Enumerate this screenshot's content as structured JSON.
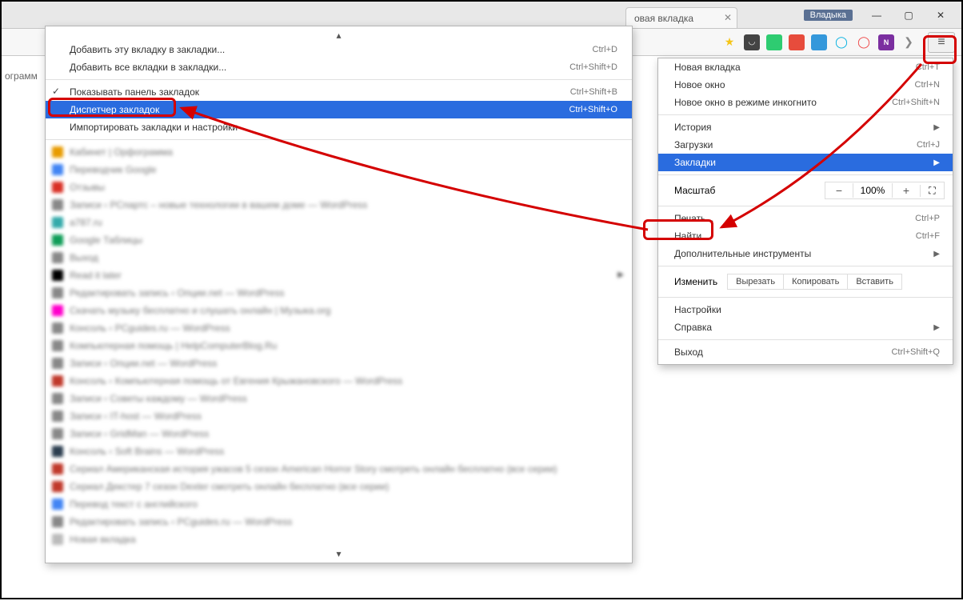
{
  "browser": {
    "tab_title": "овая вкладка",
    "user_badge": "Владыка"
  },
  "main_menu": {
    "new_tab": "Новая вкладка",
    "new_tab_sc": "Ctrl+T",
    "new_window": "Новое окно",
    "new_window_sc": "Ctrl+N",
    "incognito": "Новое окно в режиме инкогнито",
    "incognito_sc": "Ctrl+Shift+N",
    "history": "История",
    "downloads": "Загрузки",
    "downloads_sc": "Ctrl+J",
    "bookmarks": "Закладки",
    "zoom_label": "Масштаб",
    "zoom_value": "100%",
    "print": "Печать...",
    "print_sc": "Ctrl+P",
    "find": "Найти...",
    "find_sc": "Ctrl+F",
    "more_tools": "Дополнительные инструменты",
    "edit_label": "Изменить",
    "cut": "Вырезать",
    "copy": "Копировать",
    "paste": "Вставить",
    "settings": "Настройки",
    "help": "Справка",
    "exit": "Выход",
    "exit_sc": "Ctrl+Shift+Q"
  },
  "bk_menu": {
    "add_this": "Добавить эту вкладку в закладки...",
    "add_this_sc": "Ctrl+D",
    "add_all": "Добавить все вкладки в закладки...",
    "add_all_sc": "Ctrl+Shift+D",
    "show_bar": "Показывать панель закладок",
    "show_bar_sc": "Ctrl+Shift+B",
    "manager": "Диспетчер закладок",
    "manager_sc": "Ctrl+Shift+O",
    "import_set": "Импортировать закладки и настройки"
  },
  "bk_entries": [
    "Кабинет | Орфограмма",
    "Переводчик Google",
    "Отзывы",
    "Записи ‹ PCпартс – новые технологии в вашем доме — WordPress",
    "a787.ru",
    "Google Таблицы",
    "Выход",
    "Read it later",
    "Редактировать запись ‹ Опции.net — WordPress",
    "Скачать музыку бесплатно и слушать онлайн | Музыка.org",
    "Консоль ‹ PCguides.ru — WordPress",
    "Компьютерная помощь | HelpComputerBlog.Ru",
    "Записи ‹ Опции.net — WordPress",
    "Консоль ‹ Компьютерная помощь от Евгения Крыжановского — WordPress",
    "Записи ‹ Советы каждому — WordPress",
    "Записи ‹ IT-host — WordPress",
    "Записи ‹ GridMan — WordPress",
    "Консоль ‹ Soft Brains — WordPress",
    "Сериал Американская история ужасов 5 сезон American Horror Story смотреть онлайн бесплатно (все серии)",
    "Сериал Декстер 7 сезон Dexter смотреть онлайн бесплатно (все серии)",
    "Перевод текст с английского",
    "Редактировать запись ‹ PCguides.ru — WordPress",
    "Новая вкладка"
  ],
  "bk_favicons": [
    "#e89b00",
    "#4285f4",
    "#d93025",
    "#888",
    "#3aa",
    "#0f9d58",
    "#888",
    "#000",
    "#888",
    "#f0c",
    "#888",
    "#888",
    "#888",
    "#c0392b",
    "#888",
    "#888",
    "#888",
    "#2c3e50",
    "#c0392b",
    "#c0392b",
    "#4285f4",
    "#888",
    "#bbb"
  ],
  "bk_has_submenu_index": 7,
  "page_label": "ограмм"
}
